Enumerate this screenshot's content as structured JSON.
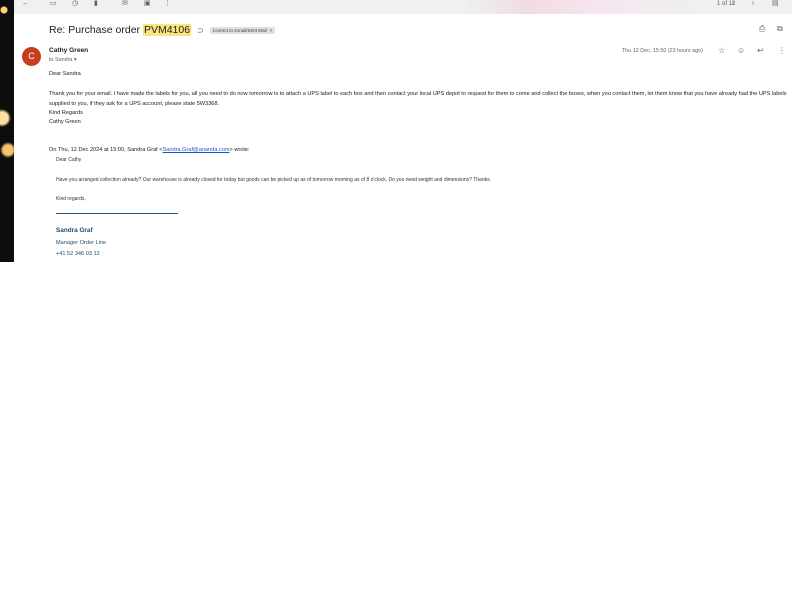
{
  "toolbar": {
    "icons": [
      "back-arrow-icon",
      "archive-icon",
      "snooze-icon",
      "report-icon",
      "mail-icon",
      "label-icon",
      "more-icon"
    ],
    "pager": "1 of 12"
  },
  "email": {
    "subject_prefix": "Re: Purchase order ",
    "subject_highlight": "PVM4106",
    "label_chip": "Correct to Gmail/Sent Mail",
    "sender_initial": "C",
    "sender_name": "Cathy Green",
    "to_line": "to Sandra",
    "date": "Thu 12 Dec, 15:50 (23 hours ago)",
    "body": {
      "greeting": "Dear Sandra",
      "paragraph": "Thank you for your email. I have made the labels for you, all you need to do now tomorrow is to attach a UPS label to each box and then contact your local UPS depot to request for them to come and collect the boxes, when you contact them, let them know that you have already had the UPS labels supplied to you, if they ask for a UPS account, please state 5W3368.",
      "regards": "Kind Regards",
      "signature": "Cathy Green"
    },
    "quote": {
      "header_prefix": "On Thu, 12 Dec 2024 at 15:00, Sandra Graf <",
      "header_email": "Sandra.Graf@ananda.com",
      "header_suffix": "> wrote:",
      "greeting": "Dear Cathy",
      "paragraph": "Have you arranged collection already? Our warehouse is already closed for today but goods can be picked up as of tomorrow morning as of 8 o'clock. Do you need weight and dimensions? Thanks.",
      "regards": "Kind regards,",
      "sig_name": "Sandra Graf",
      "sig_role": "Manager Order Line",
      "sig_phone": "+41 52 346 03 12"
    }
  },
  "colors": {
    "avatar": "#c73d1e",
    "highlight": "#fce57f",
    "signature": "#1f4e6e",
    "link": "#1a57c4"
  }
}
